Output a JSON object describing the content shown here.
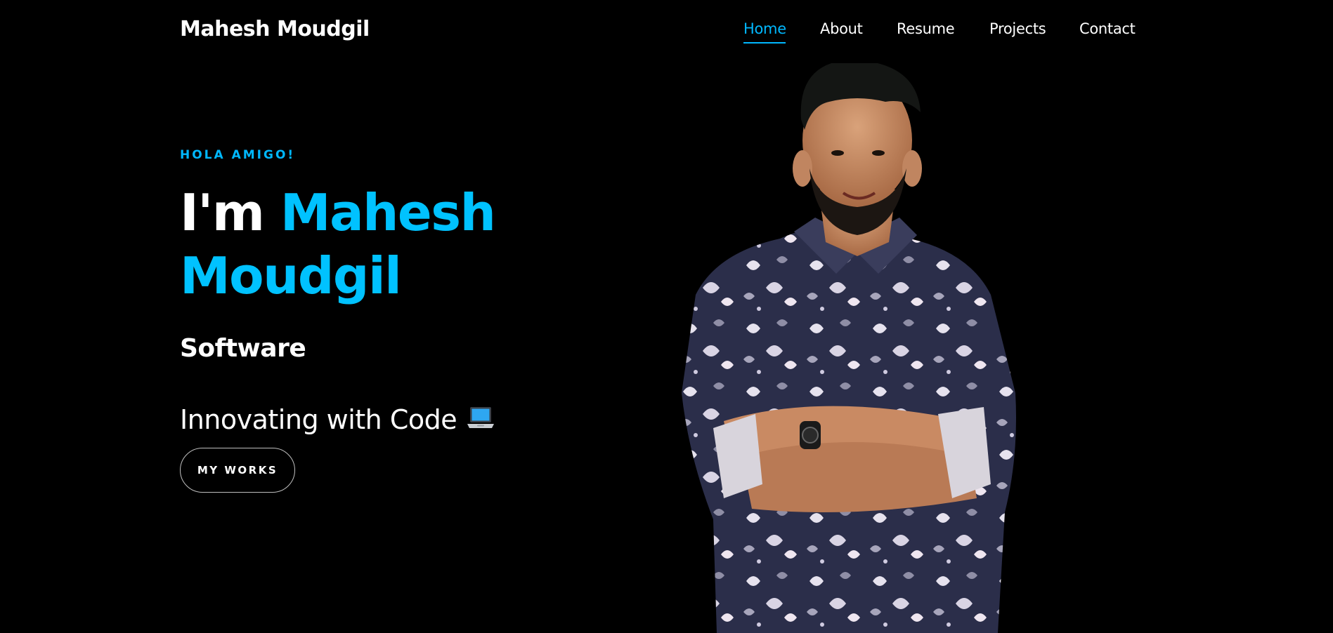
{
  "header": {
    "brand": "Mahesh Moudgil",
    "nav": [
      {
        "label": "Home",
        "active": true
      },
      {
        "label": "About",
        "active": false
      },
      {
        "label": "Resume",
        "active": false
      },
      {
        "label": "Projects",
        "active": false
      },
      {
        "label": "Contact",
        "active": false
      }
    ]
  },
  "hero": {
    "eyebrow": "HOLA AMIGO!",
    "title_prefix": "I'm ",
    "title_name": "Mahesh Moudgil",
    "role": "Software",
    "tagline": "Innovating with Code",
    "tagline_icon": "laptop-icon",
    "cta_label": "MY WORKS"
  },
  "portrait": {
    "icon": "person-portrait"
  },
  "colors": {
    "background": "#000000",
    "accent": "#00c2ff",
    "text": "#ffffff"
  }
}
